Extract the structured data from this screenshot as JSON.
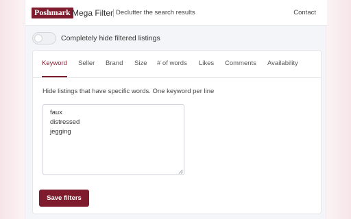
{
  "header": {
    "logo_text": "Poshmark",
    "brand_name": "Mega Filter",
    "tagline": "Declutter the search results",
    "contact_label": "Contact"
  },
  "toggle": {
    "label": "Completely hide filtered listings",
    "enabled": false
  },
  "tabs": [
    {
      "label": "Keyword",
      "active": true
    },
    {
      "label": "Seller",
      "active": false
    },
    {
      "label": "Brand",
      "active": false
    },
    {
      "label": "Size",
      "active": false
    },
    {
      "label": "# of words",
      "active": false
    },
    {
      "label": "Likes",
      "active": false
    },
    {
      "label": "Comments",
      "active": false
    },
    {
      "label": "Availability",
      "active": false
    }
  ],
  "keyword_panel": {
    "instruction": "Hide listings that have specific words. One keyword per line",
    "keywords": [
      "faux",
      "distressed",
      "jegging"
    ]
  },
  "save_button_label": "Save filters",
  "colors": {
    "brand": "#7e1c2d",
    "panel_bg": "#f4f5f8",
    "page_bg": "#fbf1f2"
  }
}
